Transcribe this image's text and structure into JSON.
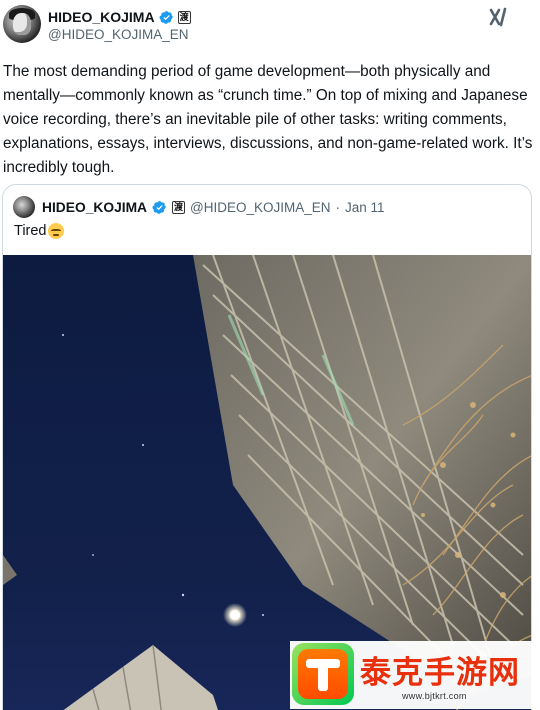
{
  "post": {
    "author": {
      "display_name": "HIDEO_KOJIMA",
      "handle": "@HIDEO_KOJIMA_EN",
      "affiliate_badge": "渡"
    },
    "text": "The most demanding period of game development—both physically and mentally—commonly known as “crunch time.” On top of mixing and Japanese voice recording, there’s an inevitable pile of other tasks: writing comments, explanations, essays, interviews, discussions, and non-game-related work. It’s incredibly tough.",
    "grok_icon": "grok-icon"
  },
  "quote": {
    "display_name": "HIDEO_KOJIMA",
    "handle": "@HIDEO_KOJIMA_EN",
    "separator": "·",
    "date": "Jan 11",
    "text": "Tired",
    "emoji": "tired-face-emoji",
    "affiliate_badge": "渡"
  },
  "watermark": {
    "brand": "泰克手游网",
    "url": "www.bjtkrt.com"
  },
  "colors": {
    "verified_blue": "#1d9bf0",
    "secondary_text": "#536471",
    "border": "#cfd9de",
    "night_sky": "#101f48",
    "watermark_red": "#e8300c"
  }
}
